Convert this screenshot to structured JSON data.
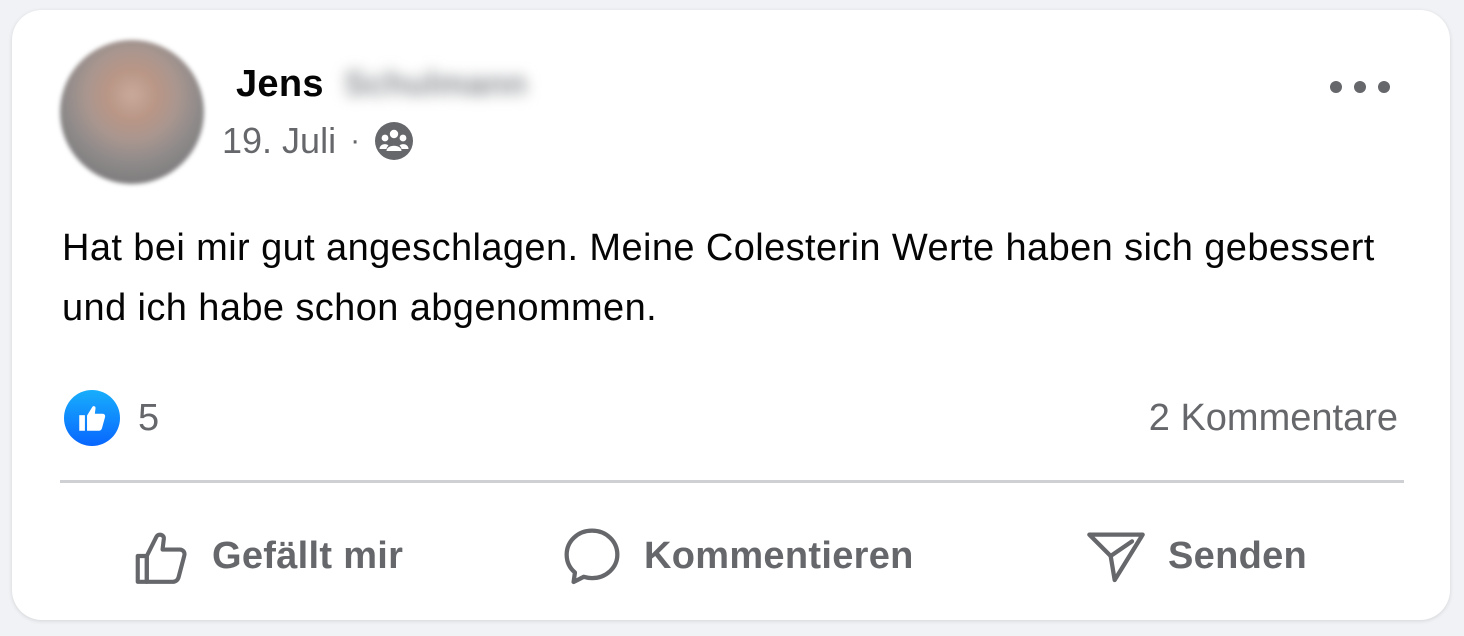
{
  "post": {
    "author_first": "Jens",
    "author_last": "Schulmann",
    "date": "19. Juli",
    "separator": "·",
    "audience_icon": "friends-group-icon",
    "text": "Hat bei mir gut angeschlagen. Meine Colesterin Werte haben sich gebessert und ich habe schon abgenommen."
  },
  "stats": {
    "reaction_icon": "like-icon",
    "reaction_count": "5",
    "comments_label": "2 Kommentare"
  },
  "actions": {
    "like_label": "Gefällt mir",
    "comment_label": "Kommentieren",
    "share_label": "Senden"
  },
  "colors": {
    "like_blue": "#0866ff",
    "secondary_text": "#65676b",
    "primary_text": "#050505",
    "divider": "#ced0d4"
  }
}
